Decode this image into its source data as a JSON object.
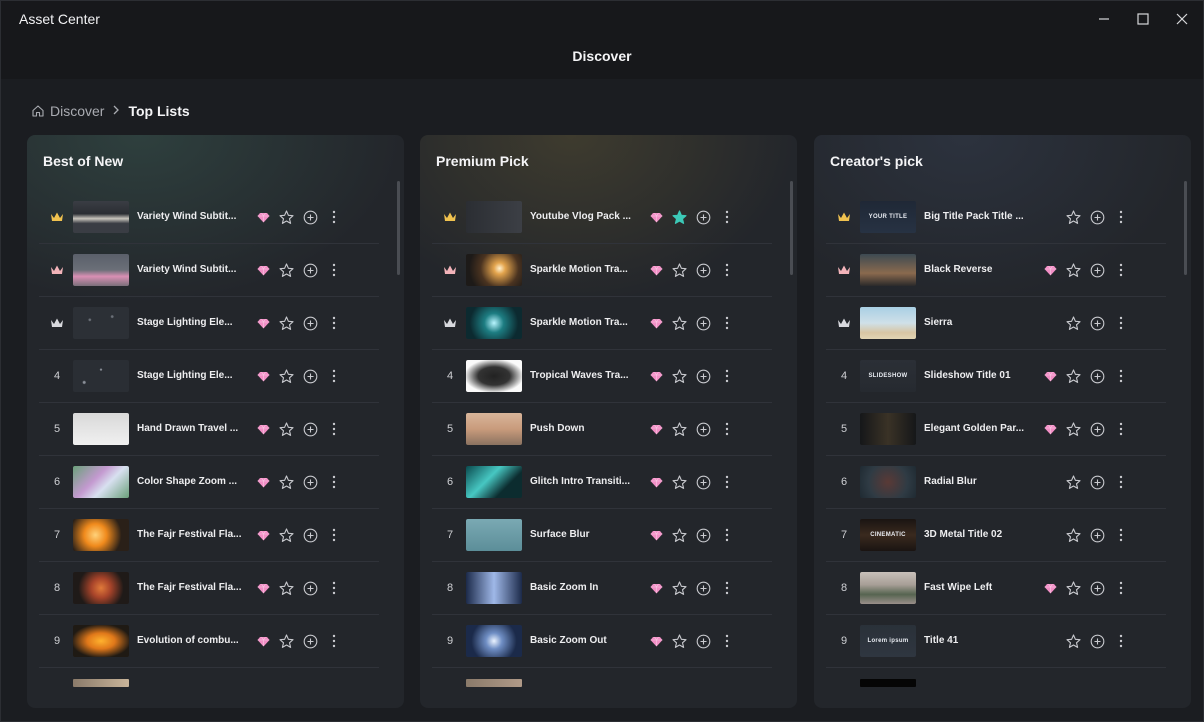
{
  "window": {
    "title": "Asset Center",
    "controls": [
      "minimize",
      "maximize",
      "close"
    ]
  },
  "header": {
    "title": "Discover"
  },
  "breadcrumb": {
    "home": "Discover",
    "current": "Top Lists"
  },
  "colors": {
    "premium_gem": "#f28fc6",
    "favorited_star": "#3cc9b7",
    "crown_gold": "#f0c24f",
    "crown_rose": "#f2b3b9",
    "crown_silver": "#d8d9de"
  },
  "panels": [
    {
      "title": "Best of New",
      "items": [
        {
          "rank": "1",
          "name": "Variety Wind Subtit...",
          "premium": true,
          "favorited": false
        },
        {
          "rank": "2",
          "name": "Variety Wind Subtit...",
          "premium": true,
          "favorited": false
        },
        {
          "rank": "3",
          "name": "Stage Lighting Ele...",
          "premium": true,
          "favorited": false
        },
        {
          "rank": "4",
          "name": "Stage Lighting Ele...",
          "premium": true,
          "favorited": false
        },
        {
          "rank": "5",
          "name": "Hand Drawn Travel ...",
          "premium": true,
          "favorited": false
        },
        {
          "rank": "6",
          "name": "Color Shape Zoom ...",
          "premium": true,
          "favorited": false
        },
        {
          "rank": "7",
          "name": "The Fajr Festival Fla...",
          "premium": true,
          "favorited": false
        },
        {
          "rank": "8",
          "name": "The Fajr Festival Fla...",
          "premium": true,
          "favorited": false
        },
        {
          "rank": "9",
          "name": "Evolution of combu...",
          "premium": true,
          "favorited": false
        }
      ]
    },
    {
      "title": "Premium Pick",
      "items": [
        {
          "rank": "1",
          "name": "Youtube Vlog Pack ...",
          "premium": true,
          "favorited": true
        },
        {
          "rank": "2",
          "name": "Sparkle Motion Tra...",
          "premium": true,
          "favorited": false
        },
        {
          "rank": "3",
          "name": "Sparkle Motion Tra...",
          "premium": true,
          "favorited": false
        },
        {
          "rank": "4",
          "name": "Tropical Waves Tra...",
          "premium": true,
          "favorited": false
        },
        {
          "rank": "5",
          "name": "Push Down",
          "premium": true,
          "favorited": false
        },
        {
          "rank": "6",
          "name": "Glitch Intro Transiti...",
          "premium": true,
          "favorited": false
        },
        {
          "rank": "7",
          "name": "Surface Blur",
          "premium": true,
          "favorited": false
        },
        {
          "rank": "8",
          "name": "Basic Zoom In",
          "premium": true,
          "favorited": false
        },
        {
          "rank": "9",
          "name": "Basic Zoom Out",
          "premium": true,
          "favorited": false
        }
      ]
    },
    {
      "title": "Creator's pick",
      "items": [
        {
          "rank": "1",
          "name": "Big Title Pack Title ...",
          "premium": false,
          "favorited": false,
          "thumb_text": "YOUR TITLE"
        },
        {
          "rank": "2",
          "name": "Black Reverse",
          "premium": true,
          "favorited": false
        },
        {
          "rank": "3",
          "name": "Sierra",
          "premium": false,
          "favorited": false
        },
        {
          "rank": "4",
          "name": "Slideshow Title 01",
          "premium": true,
          "favorited": false,
          "thumb_text": "SLIDESHOW"
        },
        {
          "rank": "5",
          "name": "Elegant Golden Par...",
          "premium": true,
          "favorited": false
        },
        {
          "rank": "6",
          "name": "Radial Blur",
          "premium": false,
          "favorited": false
        },
        {
          "rank": "7",
          "name": "3D Metal Title 02",
          "premium": false,
          "favorited": false,
          "thumb_text": "CINEMATIC"
        },
        {
          "rank": "8",
          "name": "Fast Wipe Left",
          "premium": true,
          "favorited": false
        },
        {
          "rank": "9",
          "name": "Title 41",
          "premium": false,
          "favorited": false,
          "thumb_text": "Lorem ipsum"
        }
      ]
    }
  ]
}
